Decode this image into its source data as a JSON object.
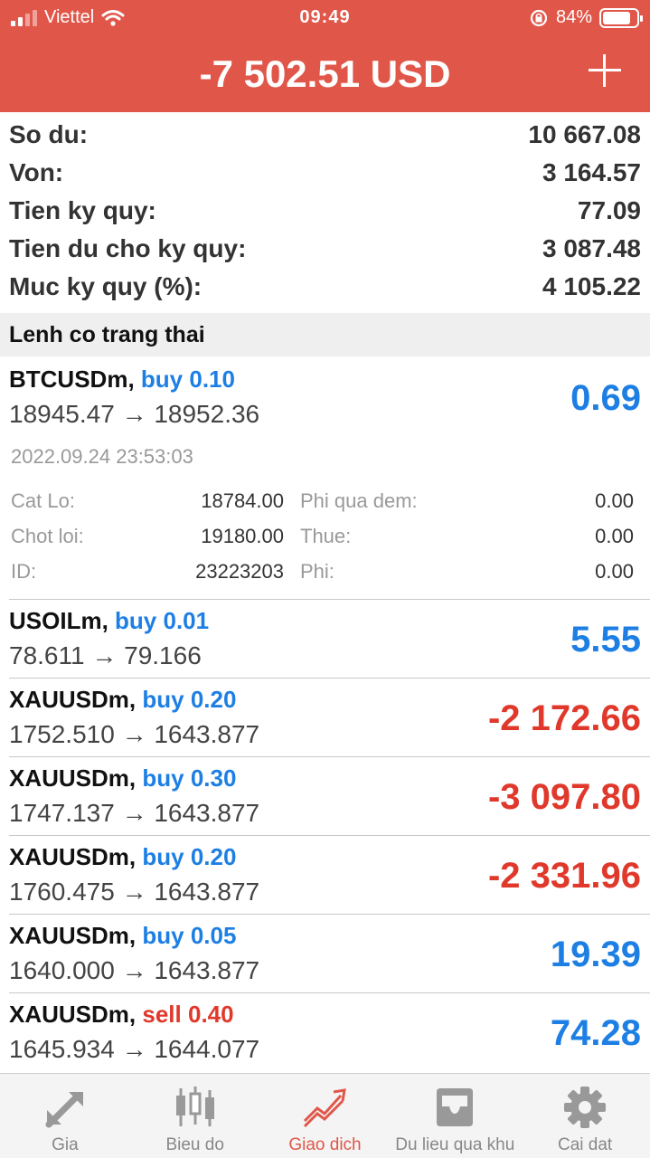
{
  "status_bar": {
    "carrier": "Viettel",
    "time": "09:49",
    "battery": "84%"
  },
  "header": {
    "title": "-7 502.51 USD"
  },
  "summary": [
    {
      "label": "So du:",
      "value": "10 667.08"
    },
    {
      "label": "Von:",
      "value": "3 164.57"
    },
    {
      "label": "Tien ky quy:",
      "value": "77.09"
    },
    {
      "label": "Tien du cho ky quy:",
      "value": "3 087.48"
    },
    {
      "label": "Muc ky quy (%):",
      "value": "4 105.22"
    }
  ],
  "section_title": "Lenh co trang thai",
  "positions": [
    {
      "symbol": "BTCUSDm,",
      "side": "buy",
      "volume": "0.10",
      "price_line": "18945.47 → 18952.36",
      "profit": "0.69",
      "direction": "up"
    },
    {
      "symbol": "USOILm,",
      "side": "buy",
      "volume": "0.01",
      "price_line": "78.611 → 79.166",
      "profit": "5.55",
      "direction": "up"
    },
    {
      "symbol": "XAUUSDm,",
      "side": "buy",
      "volume": "0.20",
      "price_line": "1752.510 → 1643.877",
      "profit": "-2 172.66",
      "direction": "down"
    },
    {
      "symbol": "XAUUSDm,",
      "side": "buy",
      "volume": "0.30",
      "price_line": "1747.137 → 1643.877",
      "profit": "-3 097.80",
      "direction": "down"
    },
    {
      "symbol": "XAUUSDm,",
      "side": "buy",
      "volume": "0.20",
      "price_line": "1760.475 → 1643.877",
      "profit": "-2 331.96",
      "direction": "down"
    },
    {
      "symbol": "XAUUSDm,",
      "side": "buy",
      "volume": "0.05",
      "price_line": "1640.000 → 1643.877",
      "profit": "19.39",
      "direction": "up"
    },
    {
      "symbol": "XAUUSDm,",
      "side": "sell",
      "volume": "0.40",
      "price_line": "1645.934 → 1644.077",
      "profit": "74.28",
      "direction": "up"
    }
  ],
  "detail": {
    "date": "2022.09.24 23:53:03",
    "rows": [
      {
        "label1": "Cat Lo:",
        "value1": "18784.00",
        "label2": "Phi qua dem:",
        "value2": "0.00"
      },
      {
        "label1": "Chot loi:",
        "value1": "19180.00",
        "label2": "Thue:",
        "value2": "0.00"
      },
      {
        "label1": "ID:",
        "value1": "23223203",
        "label2": "Phi:",
        "value2": "0.00"
      }
    ]
  },
  "tabs": [
    {
      "label": "Gia",
      "icon": "quotes-arrows-icon"
    },
    {
      "label": "Bieu do",
      "icon": "candlestick-chart-icon"
    },
    {
      "label": "Giao dich",
      "icon": "trade-trend-icon",
      "active": true
    },
    {
      "label": "Du lieu qua khu",
      "icon": "history-inbox-icon"
    },
    {
      "label": "Cai dat",
      "icon": "gear-icon"
    }
  ],
  "colors": {
    "header_bg": "#e0574a",
    "profit_positive": "#1d7fe3",
    "profit_negative": "#e0382b",
    "active_tab": "#e0574a"
  }
}
